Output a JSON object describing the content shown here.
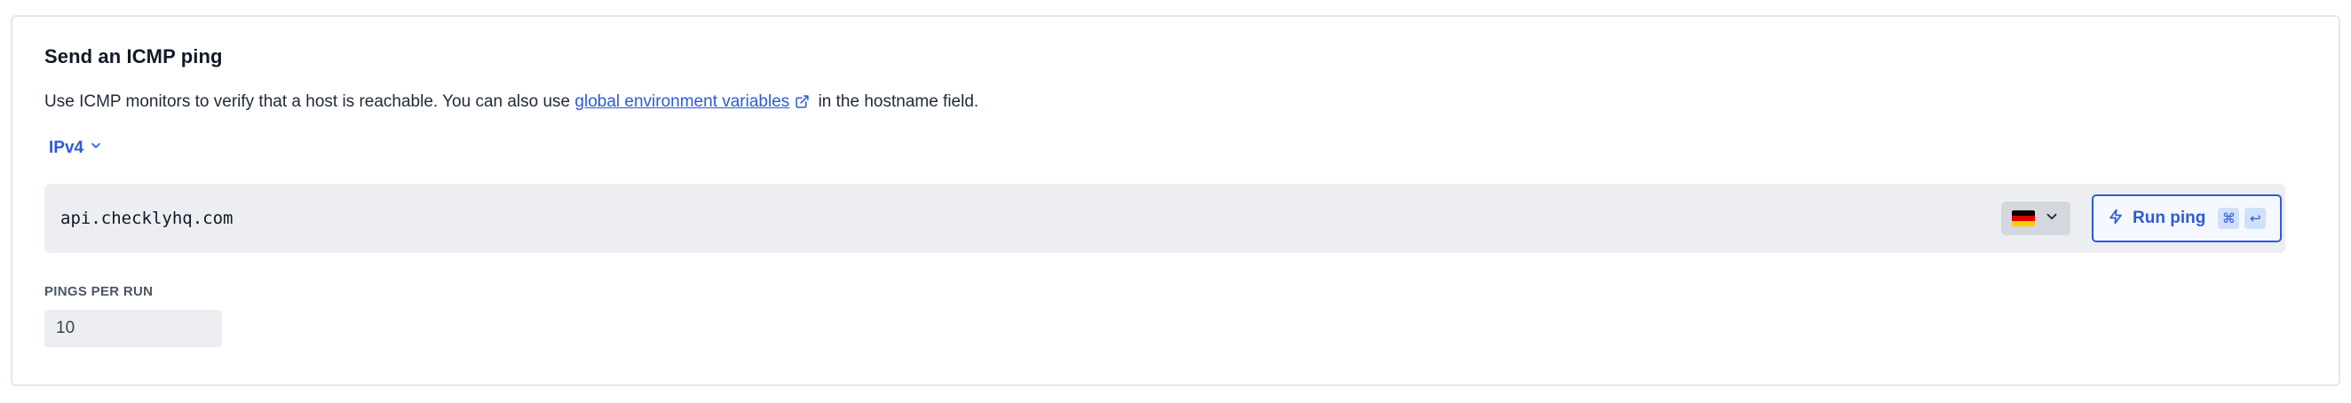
{
  "card": {
    "title": "Send an ICMP ping",
    "description_before": "Use ICMP monitors to verify that a host is reachable. You can also use",
    "link_text": "global environment variables",
    "description_after": "in the hostname field."
  },
  "ip_version": {
    "selected": "IPv4",
    "icon": "chevron-down-icon"
  },
  "host": {
    "value": "api.checklyhq.com"
  },
  "region": {
    "icon": "germany-flag-icon",
    "flag_colors": [
      "#000000",
      "#dd0000",
      "#ffce00"
    ]
  },
  "run_button": {
    "label": "Run ping",
    "icon": "bolt-icon",
    "shortcut_keys": [
      "⌘",
      "↩"
    ]
  },
  "pings_per_run": {
    "label": "PINGS PER RUN",
    "value": "10"
  },
  "colors": {
    "accent": "#2b5bd7",
    "input_bg": "#edeef2",
    "border": "#e5e7eb"
  }
}
